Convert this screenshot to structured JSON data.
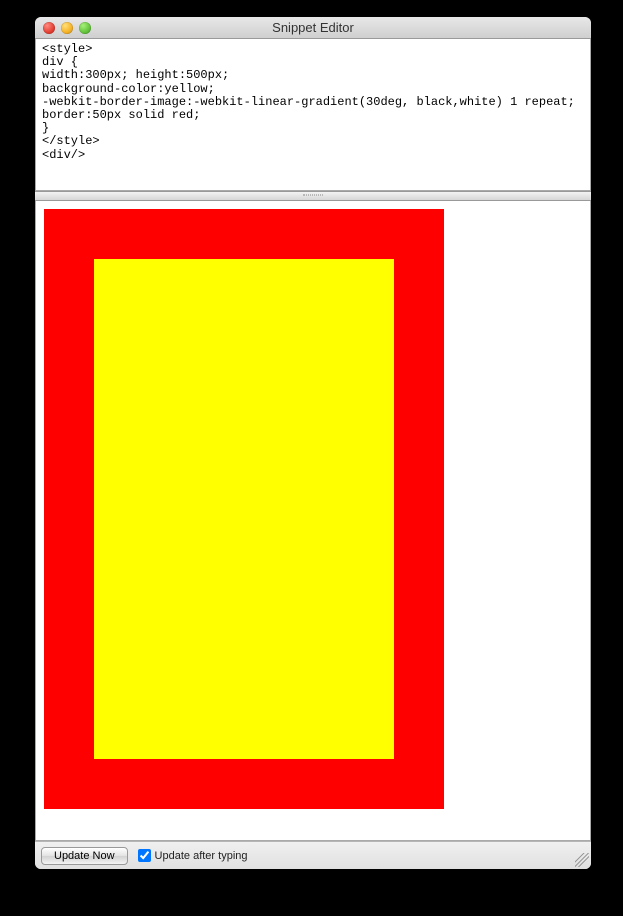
{
  "window": {
    "title": "Snippet Editor"
  },
  "traffic": {
    "close": "close",
    "minimize": "minimize",
    "zoom": "zoom"
  },
  "editor": {
    "code": "<style>\ndiv {\nwidth:300px; height:500px;\nbackground-color:yellow;\n-webkit-border-image:-webkit-linear-gradient(30deg, black,white) 1 repeat;\nborder:50px solid red;\n}\n</style>\n<div/>"
  },
  "footer": {
    "update_button": "Update Now",
    "auto_update_label": "Update after typing",
    "auto_update_checked": true
  }
}
